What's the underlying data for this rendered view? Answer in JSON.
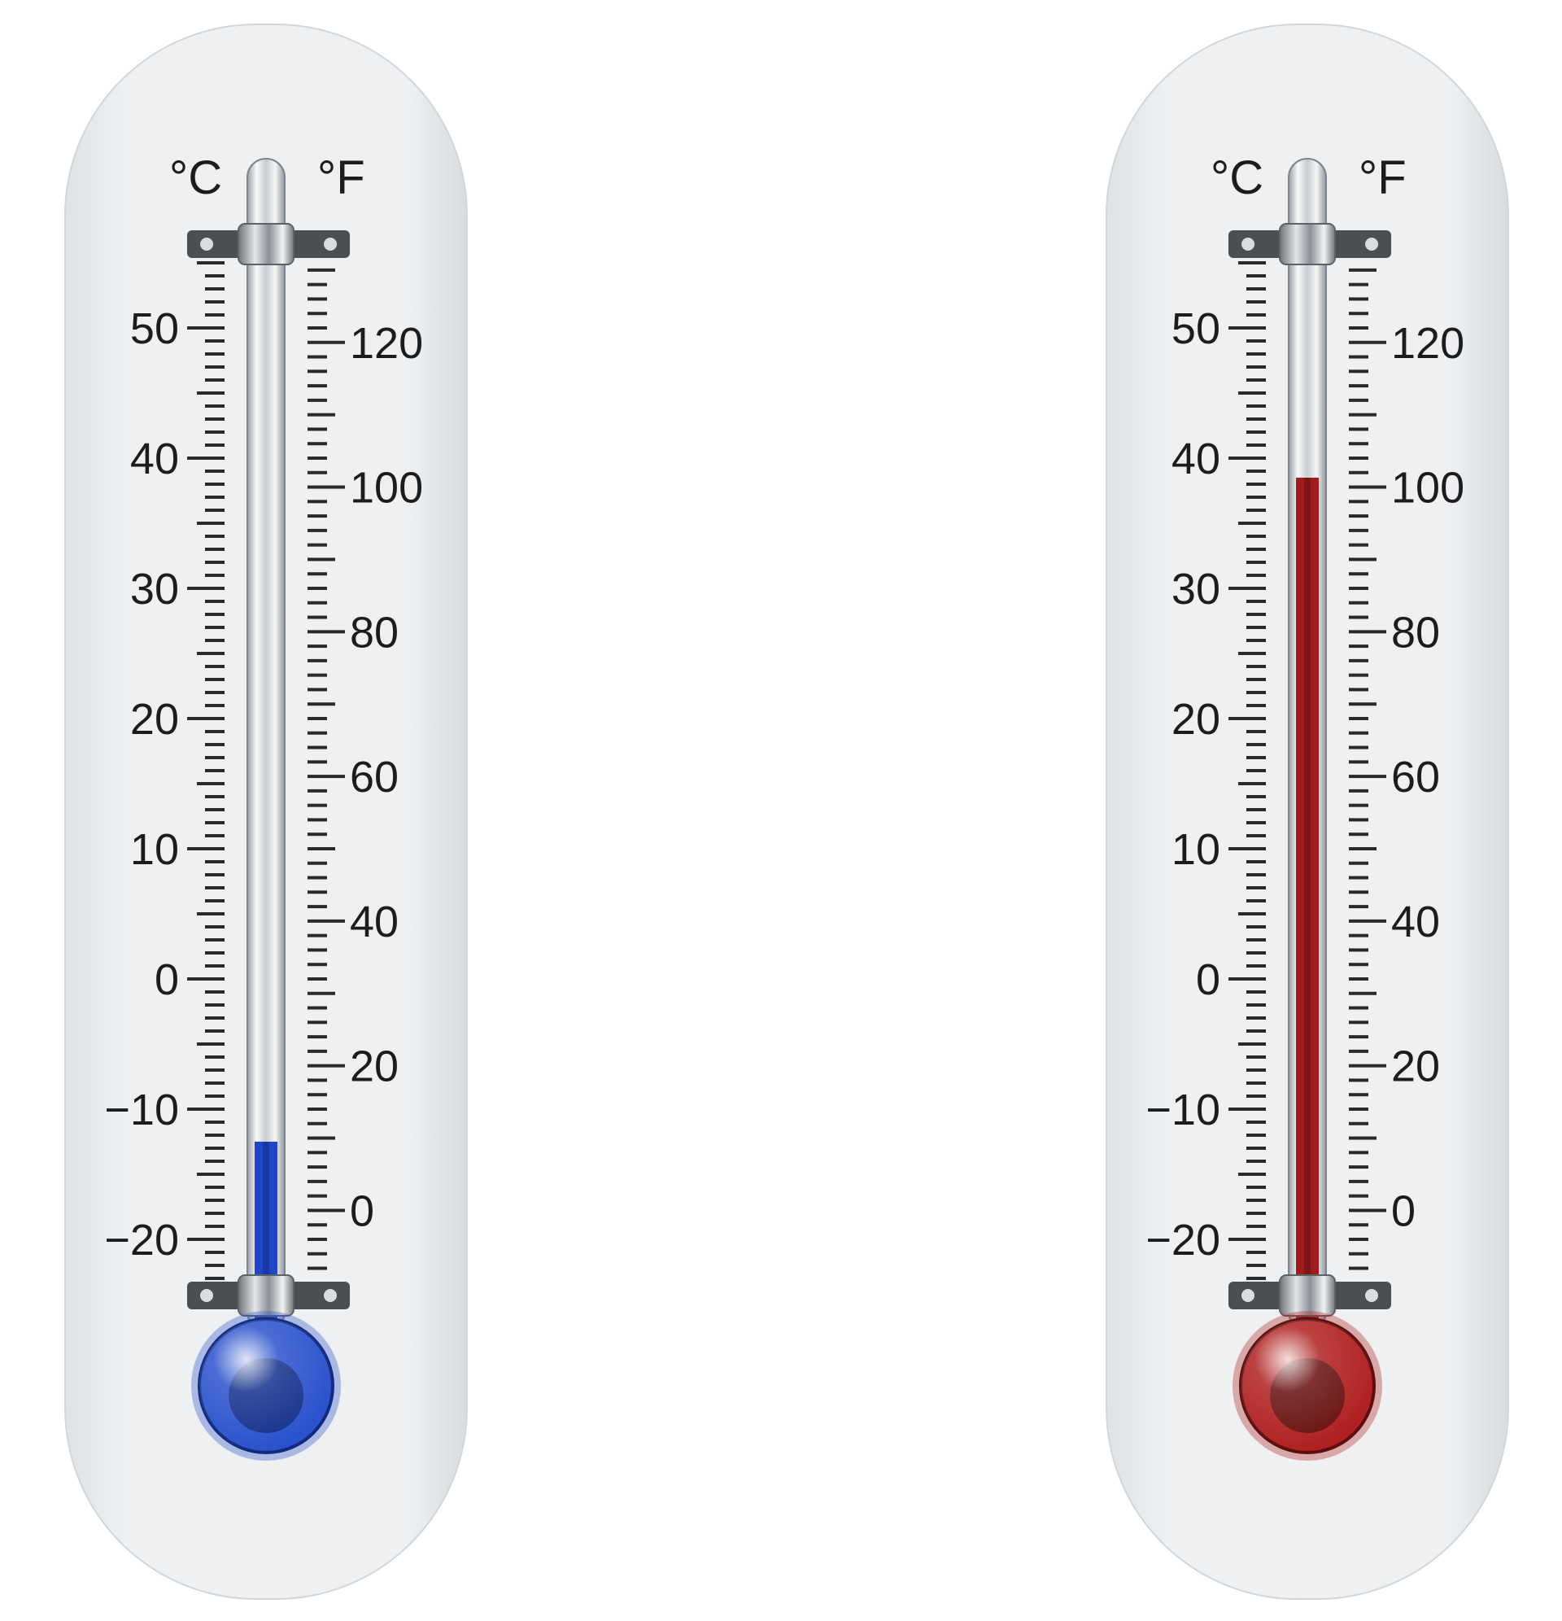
{
  "thermometers": [
    {
      "id": "cold",
      "reading_celsius": -12.5,
      "liquid_color": "#1f45c8",
      "liquid_dark": "#112a80",
      "bulb_color": "#2a52cc"
    },
    {
      "id": "hot",
      "reading_celsius": 38.5,
      "liquid_color": "#a01c1c",
      "liquid_dark": "#5c0d0d",
      "bulb_color": "#b02020"
    }
  ],
  "scale": {
    "celsius_unit": "°C",
    "fahrenheit_unit": "°F",
    "celsius_labels": [
      "50",
      "40",
      "30",
      "20",
      "10",
      "0",
      "−10",
      "−20"
    ],
    "celsius_values": [
      50,
      40,
      30,
      20,
      10,
      0,
      -10,
      -20
    ],
    "fahrenheit_labels": [
      "120",
      "100",
      "80",
      "60",
      "40",
      "20",
      "0"
    ],
    "fahrenheit_values": [
      120,
      100,
      80,
      60,
      40,
      20,
      0
    ]
  }
}
